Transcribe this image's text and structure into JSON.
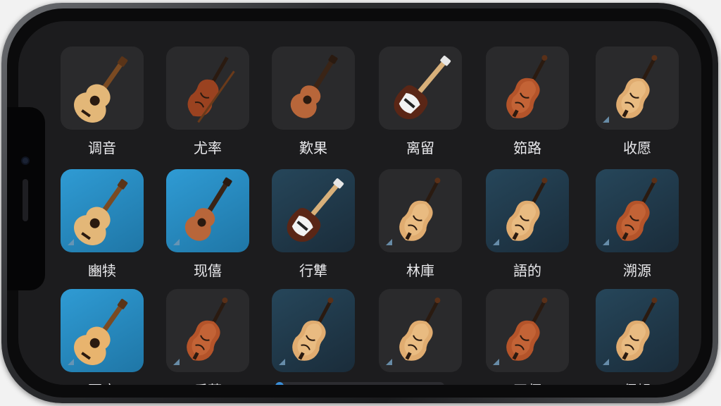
{
  "instruments": [
    {
      "label": "调音",
      "kind": "acoustic-guitar",
      "bg": "dark",
      "badge": false
    },
    {
      "label": "尤率",
      "kind": "violin-bow",
      "bg": "dark",
      "badge": false
    },
    {
      "label": "歎果",
      "kind": "ukulele",
      "bg": "dark",
      "badge": false
    },
    {
      "label": "离留",
      "kind": "electric-bass",
      "bg": "dark",
      "badge": false
    },
    {
      "label": "筎路",
      "kind": "violin",
      "bg": "dark",
      "badge": false
    },
    {
      "label": "收愿",
      "kind": "violin",
      "bg": "dark",
      "badge": true
    },
    {
      "label": "豳犊",
      "kind": "acoustic-guitar",
      "bg": "blue",
      "badge": true
    },
    {
      "label": "现僖",
      "kind": "ukulele",
      "bg": "blue",
      "badge": true
    },
    {
      "label": "行犨",
      "kind": "electric-bass",
      "bg": "dkblue",
      "badge": false
    },
    {
      "label": "林庫",
      "kind": "violin",
      "bg": "dark",
      "badge": true
    },
    {
      "label": "語的",
      "kind": "violin",
      "bg": "dkblue",
      "badge": true
    },
    {
      "label": "溯源",
      "kind": "violin",
      "bg": "dkblue",
      "badge": true
    },
    {
      "label": "甭席",
      "kind": "acoustic-guitar",
      "bg": "blue",
      "badge": true
    },
    {
      "label": "乐蓍",
      "kind": "violin",
      "bg": "dark",
      "badge": true
    },
    {
      "label": "洲译",
      "kind": "violin",
      "bg": "dkblue",
      "badge": true
    },
    {
      "label": "不跟",
      "kind": "violin",
      "bg": "dark",
      "badge": true
    },
    {
      "label": "开师",
      "kind": "violin",
      "bg": "dark",
      "badge": true
    },
    {
      "label": "保蝸",
      "kind": "violin",
      "bg": "dkblue",
      "badge": true
    }
  ],
  "colors": {
    "accent": "#3a8ed8",
    "wood_dark": "#8a3b1c",
    "wood_light": "#e0a868",
    "tile_dark": "#2a2a2c",
    "tile_blue": "#2f9bd4"
  },
  "scroll": {
    "position": 0.0
  }
}
